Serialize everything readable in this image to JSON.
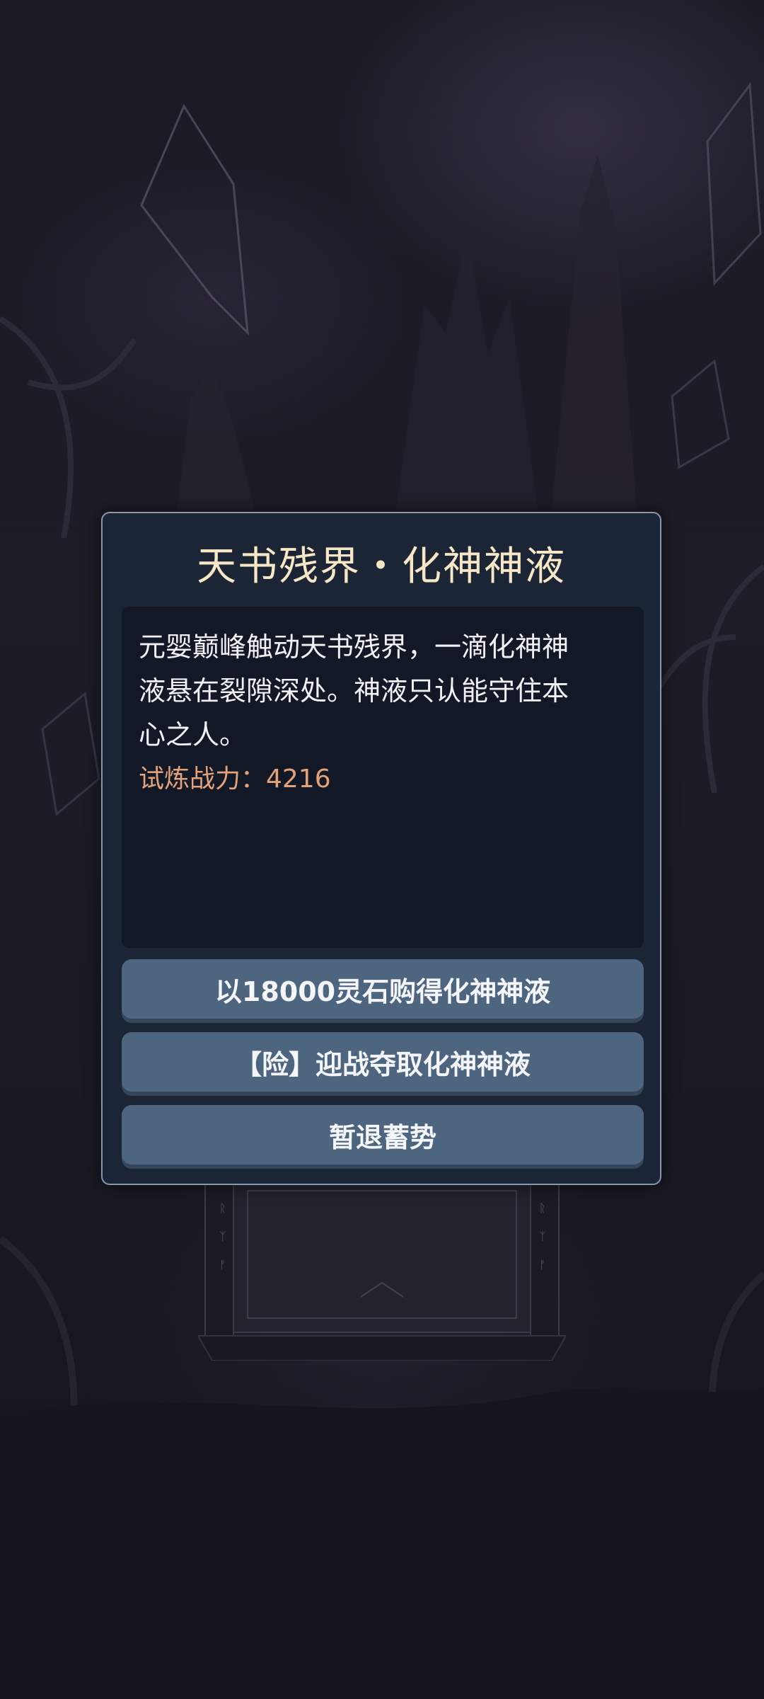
{
  "dialog": {
    "title": "天书残界・化神神液",
    "story_lines": [
      "元婴巅峰触动天书残界，一滴化神神",
      "液悬在裂隙深处。神液只认能守住本",
      "心之人。"
    ],
    "power_label": "试炼战力：4216"
  },
  "options": [
    {
      "label": "以18000灵石购得化神神液"
    },
    {
      "label": "【险】迎战夺取化神神液"
    },
    {
      "label": "暂退蓄势"
    }
  ],
  "colors": {
    "title": "#f6e7c7",
    "power": "#e3a27a",
    "button": "#4e6580",
    "panel": "#1c2535"
  }
}
